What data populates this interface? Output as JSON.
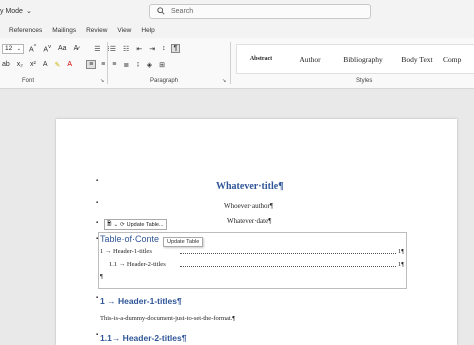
{
  "titlebar": {
    "mode_label": "y Mode",
    "search_placeholder": "Search"
  },
  "menu": [
    "References",
    "Mailings",
    "Review",
    "View",
    "Help"
  ],
  "ribbon": {
    "font_size": "12",
    "font_label": "Font",
    "paragraph_label": "Paragraph",
    "styles_label": "Styles",
    "styles": [
      "Abstract",
      "Author",
      "Bibliography",
      "Body Text",
      "Comp"
    ]
  },
  "document": {
    "title": "Whatever·title¶",
    "author": "Whoever·author¶",
    "date": "Whatever·date¶",
    "toc_title": "Table·of·Conte",
    "toc_update_button": "Update Table...",
    "toc_tooltip": "Update Table",
    "toc_entry1": "1 → Header-1-titles",
    "toc_entry1_page": "1¶",
    "toc_entry2": "1.1 → Header-2-titles",
    "toc_entry2_page": "1¶",
    "toc_end": "¶",
    "h1": "1 → Header-1-titles¶",
    "body": "This-is-a-dummy-document-just-to-set-the-format.¶",
    "h2": "1.1→ Header-2-titles¶"
  }
}
